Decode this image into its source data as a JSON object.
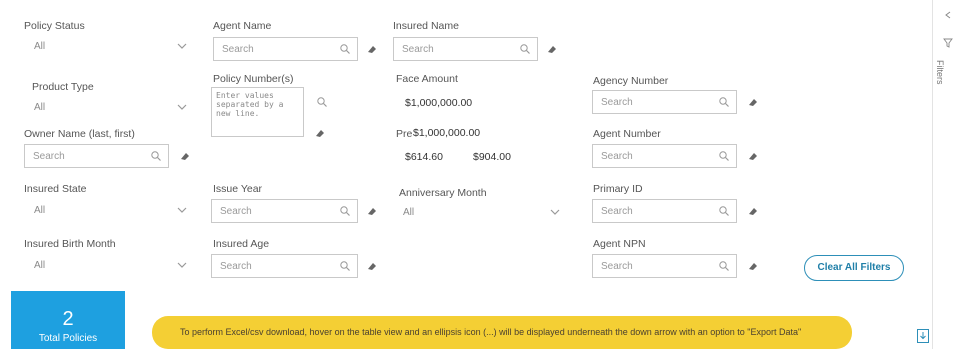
{
  "filters": {
    "policy_status": {
      "label": "Policy Status",
      "value": "All"
    },
    "agent_name": {
      "label": "Agent Name",
      "placeholder": "Search"
    },
    "insured_name": {
      "label": "Insured Name",
      "placeholder": "Search"
    },
    "product_type": {
      "label": "Product Type",
      "value": "All"
    },
    "policy_numbers": {
      "label": "Policy Number(s)",
      "placeholder": "Enter values\nseparated by a\nnew line."
    },
    "face_amount": {
      "label": "Face Amount",
      "value": "$1,000,000.00",
      "value2": "$1,000,000.00"
    },
    "agency_number": {
      "label": "Agency Number",
      "placeholder": "Search"
    },
    "owner_name": {
      "label": "Owner Name (last, first)",
      "placeholder": "Search"
    },
    "premium": {
      "label": "Pre",
      "min": "$614.60",
      "max": "$904.00"
    },
    "agent_number": {
      "label": "Agent Number",
      "placeholder": "Search"
    },
    "insured_state": {
      "label": "Insured State",
      "value": "All"
    },
    "issue_year": {
      "label": "Issue Year",
      "placeholder": "Search"
    },
    "anniversary_month": {
      "label": "Anniversary Month",
      "value": "All"
    },
    "primary_id": {
      "label": "Primary ID",
      "placeholder": "Search"
    },
    "insured_birth_month": {
      "label": "Insured Birth Month",
      "value": "All"
    },
    "insured_age": {
      "label": "Insured Age",
      "placeholder": "Search"
    },
    "agent_npn": {
      "label": "Agent NPN",
      "placeholder": "Search"
    }
  },
  "clear_all_label": "Clear All Filters",
  "summary": {
    "count": "2",
    "caption": "Total Policies"
  },
  "banner_text": "To perform Excel/csv download, hover on the table view and an ellipsis icon (...) will be displayed underneath the down arrow with an option to \"Export Data\"",
  "side_panel": {
    "label": "Filters"
  },
  "icons": [
    "search-icon",
    "eraser-icon",
    "chevron-down-icon",
    "download-icon"
  ],
  "colors": {
    "accent": "#1ea0e0",
    "banner": "#f4cf34",
    "button_border": "#2d8fb8"
  }
}
